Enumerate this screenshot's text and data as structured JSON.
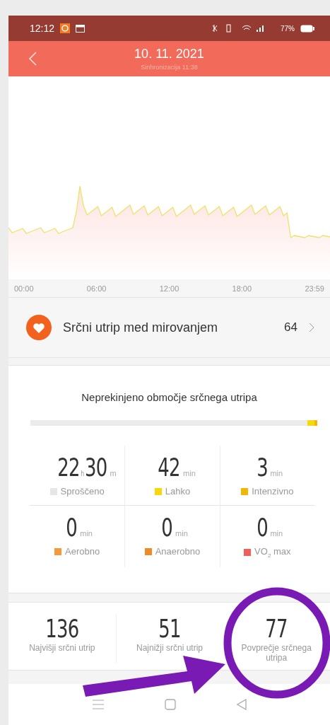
{
  "status_bar": {
    "time": "12:12",
    "battery": "77%"
  },
  "header": {
    "title": "10. 11. 2021",
    "subtitle": "Sinhronizacija 11:38"
  },
  "chart": {
    "x_labels": [
      "00:00",
      "06:00",
      "12:00",
      "18:00",
      "23:59"
    ]
  },
  "resting": {
    "label": "Srčni utrip med mirovanjem",
    "value": "64"
  },
  "zones": {
    "title": "Neprekinjeno območje srčnega utripa",
    "stats": [
      {
        "value": "22$_{h}$30",
        "unit": "m",
        "label": "Sproščeno",
        "color": "#e6e6e6"
      },
      {
        "value": "42",
        "unit": "min",
        "label": "Lahko",
        "color": "#f5d90a"
      },
      {
        "value": "3",
        "unit": "min",
        "label": "Intenzivno",
        "color": "#f2b705"
      },
      {
        "value": "0",
        "unit": "min",
        "label": "Aerobno",
        "color": "#f7983a"
      },
      {
        "value": "0",
        "unit": "min",
        "label": "Anaerobno",
        "color": "#f08a24"
      },
      {
        "value": "0",
        "unit": "min",
        "label": "VO$_{2}$ max",
        "color": "#f0605a"
      }
    ]
  },
  "summary": [
    {
      "value": "136",
      "label": "Najvišji srčni utrip"
    },
    {
      "value": "51",
      "label": "Najnižji srčni utrip"
    },
    {
      "value": "77",
      "label": "Povprečje srčnega utripa"
    }
  ],
  "annotations": [
    {
      "kind": "circle"
    },
    {
      "kind": "arrow"
    }
  ]
}
